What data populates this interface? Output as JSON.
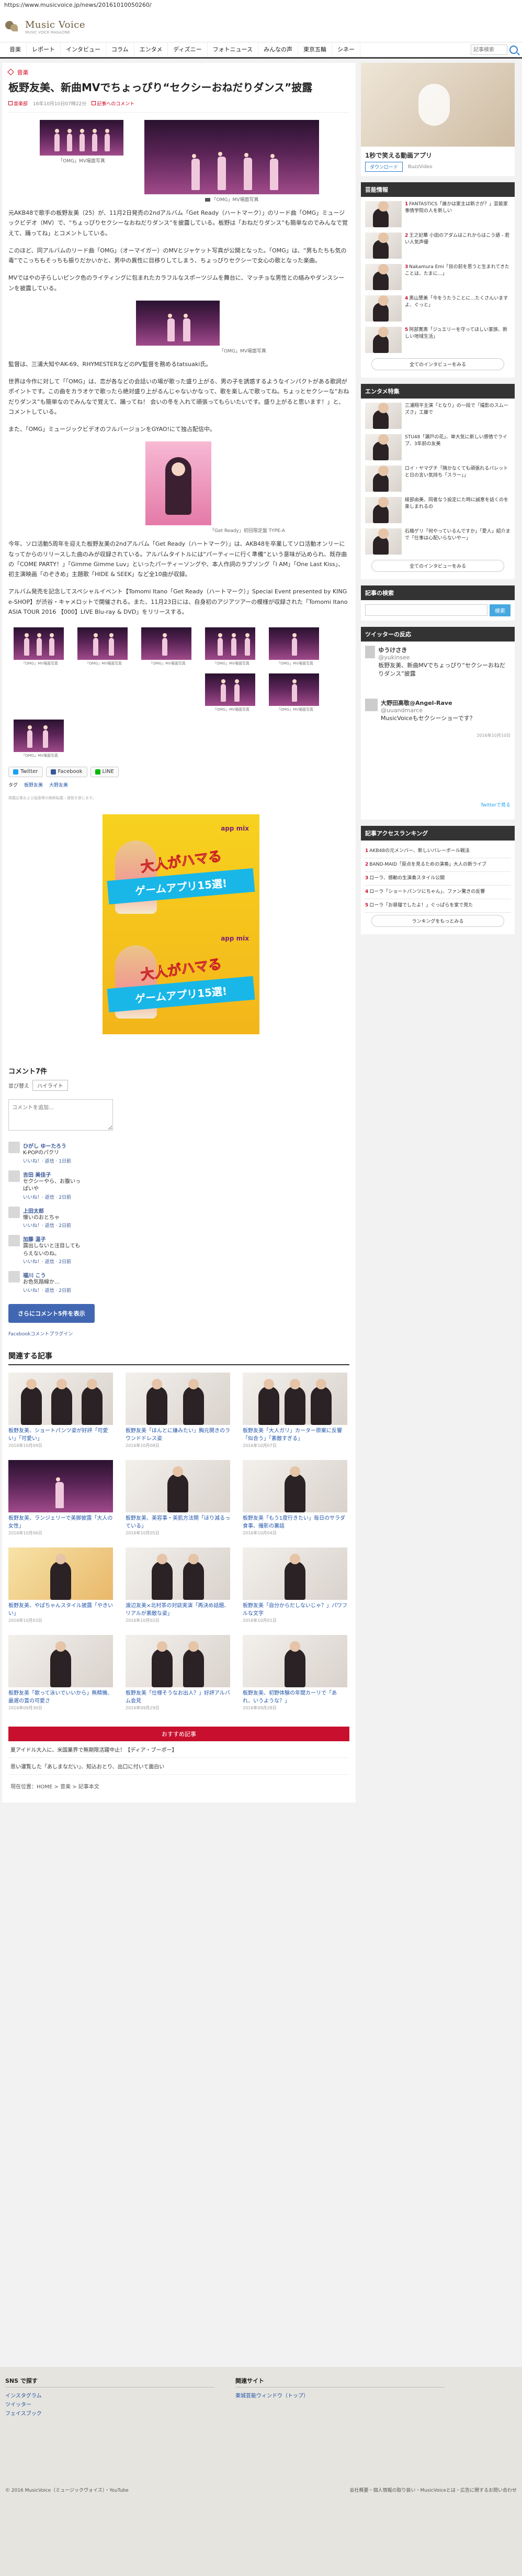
{
  "browser": {
    "url": "https://www.musicvoice.jp/news/20161010050260/"
  },
  "site": {
    "logo_text": "Music Voice",
    "logo_sub": "MUSIC VOICE MAGAZINE"
  },
  "nav": {
    "items": [
      "音楽",
      "レポート",
      "インタビュー",
      "コラム",
      "エンタメ",
      "ディズニー",
      "フォトニュース",
      "みんなの声",
      "東京五輪",
      "シネー"
    ],
    "search_placeholder": "記事検索"
  },
  "article": {
    "category": "音楽",
    "title": "板野友美、新曲MVでちょっぴり“セクシーおねだりダンス”披露",
    "author": "音楽部",
    "date": "16年10月10日07時22分",
    "comment_label": "記事へのコメント",
    "img1_caption": "「OMG」MV場面写真",
    "img2_caption": "「OMG」MV場面写真",
    "p1": "元AKB48で歌手の板野友美（25）が、11月2日発売の2ndアルバム「Get Ready（ハートマーク）」のリード曲「OMG」ミュージックビデオ（MV）で、“ちょっぴりセクシーなおねだりダンス”を披露している。板野は「おねだりダンス”も簡単なのでみんなで覚えて、踊ってね」とコメントしている。",
    "p2": "このほど、同アルバムのリード曲「OMG」（オーマイガー）のMVとジャケット写真が公開となった。「OMG」は、“男もたちも気の毒”でこっちもそっちも振りだかいかと、男中の異性に目移りしてしまう、ちょっぴりセクシーで女心の歌となった楽曲。",
    "p3": "MVではやの子らしいピンク色のライティングに包まれたカラフルなスポーツジムを舞台に、マッチョな男性との絡みやダンスシーンを披露している。",
    "img3_caption": "「OMG」MV場面写真",
    "p4": "監督は、三浦大知やAK-69、RHYMESTERなどのPV監督を務めるtatsuaki氏。",
    "p5": "世界は今作に対して「「OMG」は、恋が各などの会話いの場が歌った盛り上がる、男の子を誘惑するようなインパクトがある歌詞がポイントです。この曲をカラオケで歌ったら絶対盛り上がるんじゃないかなって、歌を楽しんで歌ってね。ちょっとセクシーな“おねだりダンス”も簡単なのでみんなで覚えて、踊ってね！ 会いの冬を入れて頑張ってもらいたいです。盛り上がると思います！」と、コメントしている。",
    "p6": "また、「OMG」ミュージックビデオのフルバージョンをGYAO!にて独占配信中。",
    "img4_caption": "「Get Ready」初回限定盤 TYPE-A",
    "p7": "今年、ソロ活動5周年を迎えた板野友美の2ndアルバム「Get Ready（ハートマーク）」は、AKB48を卒業してソロ活動オンリーになってからのリリースした曲のみが収録されている。アルバムタイトルには“パーティーに行く準備”という意味が込められ、既存曲の「COME PARTY！」「Gimme Gimme Luv」といったパーティーソングや、本人作詞のラブソング「I AM」「One Last Kiss」、初主演映画「のぞきめ」主題歌「HIDE & SEEK」など全10曲が収録。",
    "p8": "アルバム発売を記念してスペシャルイベント【Tomomi Itano「Get Ready（ハートマーク）」Special Event presented by KING e-SHOP】が渋谷・キャメロットで開催される。また、11月23日には、自身初のアジアツアーの模様が収録された「Tomomi Itano ASIA TOUR 2016 【000】LIVE Blu-ray & DVD」をリリースする。",
    "thumb_caption": "「OMG」MV場面写真",
    "share": {
      "twitter": "Twitter",
      "facebook": "Facebook",
      "line": "LINE"
    },
    "tags": {
      "label": "タグ",
      "t1": "板野友美",
      "t2": "大野友美"
    },
    "notice": "掲載記事および画像等の無断転載・複製を禁じます。"
  },
  "ad": {
    "brand": "app mix",
    "headline": "大人がハマる",
    "subline": "ゲームアプリ15選!"
  },
  "comments": {
    "header": "コメント7件",
    "sort_label": "並び替え",
    "sort_value": "ハイライト",
    "input_placeholder": "コメントを追加...",
    "items": [
      {
        "name": "ひがし ゆーたろう",
        "text": "K-POPのパクリ",
        "action": "いいね！· 返信 · 1日前"
      },
      {
        "name": "吉田 美佳子",
        "text": "セクシーやら、お腹いっぱいや",
        "action": "いいね！· 返信 · 2日前"
      },
      {
        "name": "上田太郎",
        "text": "懐いのおとちゃ",
        "action": "いいね！· 返信 · 2日前"
      },
      {
        "name": "加藤 温子",
        "text": "露出しないと注目してもらえないのね。",
        "action": "いいね！· 返信 · 2日前"
      },
      {
        "name": "福川 こう",
        "text": "お色気路線か…",
        "action": "いいね！· 返信 · 2日前"
      }
    ],
    "more_button": "さらにコメント5件を表示",
    "plugin": "Facebookコメントプラグイン"
  },
  "related": {
    "title": "関連する記事",
    "items": [
      {
        "title": "板野友美、ショートパンツ姿が好評「可愛い」「可愛い」",
        "date": "2016年10月09日"
      },
      {
        "title": "板野友美「ほんとに嫌みたい」胸元開きのラウンドドレス姿",
        "date": "2016年10月08日"
      },
      {
        "title": "板野友美「大人ガリ」カーター原案に反響「似合う」「素敵すぎる」",
        "date": "2016年10月07日"
      },
      {
        "title": "板野友美、ランジェリーで美脚披露「大人の女性」",
        "date": "2016年10月06日"
      },
      {
        "title": "板野友美、美容事・美肌方法開「ほり減るっている」",
        "date": "2016年10月05日"
      },
      {
        "title": "板野友美「もう1度行きたい」毎日のサラダ食事、撮影の裏話",
        "date": "2016年10月04日"
      },
      {
        "title": "板野友美、やぱちゃんスタイル披露「やきいい」",
        "date": "2016年10月03日"
      },
      {
        "title": "渡辺友美×北村茶の対談実演「再決め話題、リアルが素敵な姿」",
        "date": "2016年10月02日"
      },
      {
        "title": "板野友美「自分からだしないじゃ？」パワフルな文字",
        "date": "2016年10月01日"
      },
      {
        "title": "板野友美「歌って泳いでいいから」無精機、最遅の賞の可愛さ",
        "date": "2016年09月30日"
      },
      {
        "title": "板野友美「仕様そうなお出人？」好評アルバム会見",
        "date": "2016年09月29日"
      },
      {
        "title": "板野友美、初野体験の年間カーリで「あれ、いうような？」",
        "date": "2016年09月28日"
      }
    ]
  },
  "recommend": {
    "bar": "おすすめ記事",
    "l1": "夏アイドル大入に、米国業界で無期限活躍中止！【ディア・ブーポー】",
    "l2": "思い運覧した「あしまなだい」、知込おとり、出口に付いて面白い"
  },
  "breadcrumb": "現在位置：HOME > 音楽 > 記事本文",
  "sidebar": {
    "app_title": "1秒で笑える動画アプリ",
    "app_download": "ダウンロード",
    "app_brand": "BuzzVideo",
    "ranking_title": "芸能情報",
    "ranking": [
      {
        "num": "1",
        "text": "FANTASTICS「誰かは家主は新さが？」芸能家事情学院の人を新しい"
      },
      {
        "num": "2",
        "text": "王之妃華 小田のアダムはこれからはこう語 - 若い人気声優"
      },
      {
        "num": "3",
        "text": "Nakamura Emi「目の前を思うと生まれてきたことは、たまに…」"
      },
      {
        "num": "4",
        "text": "黒山慧美「今をうたうことに…たくさんいますよ、ぐっと」"
      },
      {
        "num": "5",
        "text": "阿部寛斎「ジュエリーを守ってほしい家族、新しい地域生活」"
      }
    ],
    "ranking_more": "全てのインタビューをみる",
    "entame_title": "エンタメ特集",
    "entame": [
      {
        "text": "三浦翔平主演「となり」の一段で「撮影のスムーズさ」工藤で"
      },
      {
        "text": "STU48「瀬戸の花」、単大気に新しい感情でライブ、3年前の友美"
      },
      {
        "text": "ロイ・ヤマグチ「隣かなくても頑張れるバレットと日の言い気持ち「スラー」」"
      },
      {
        "text": "綾部由美、同者なう設定にた時に誠意を話くのを楽しまれるの"
      },
      {
        "text": "石橋ゲリ「何やっているんですか」「愛人」紹介まで「仕事は心配いらないやー」"
      }
    ],
    "entame_more": "全てのインタビューをみる",
    "search_title": "記事の検索",
    "search_button": "検索",
    "twitter_title": "ツイッターの反応",
    "tweets": [
      {
        "name": "ゆうけさき",
        "handle": "@yukinsee",
        "text": "板野友美、新曲MVでちょっぴり“セクシーおねだりダンス”披露"
      },
      {
        "name": "大野田高敬@Angel-Rave",
        "handle": "@uuandmarce",
        "text": "MusicVoiceもセクシーショーです？"
      }
    ],
    "tweet_time": "2016年10月10日",
    "tweet_more": "Twitterで見る",
    "access_title": "記事アクセスランキング",
    "access": [
      {
        "num": "1",
        "text": "AKB48の元メンバー、新しいバレーボール戦法"
      },
      {
        "num": "2",
        "text": "BAND-MAID「原点を見るための演奏」大人の新ライブ"
      },
      {
        "num": "3",
        "text": "ローラ、感動の生演奏スタイル公開"
      },
      {
        "num": "4",
        "text": "ローラ「ショートパンツにちゃん」、ファン驚きの反響"
      },
      {
        "num": "5",
        "text": "ローラ「お昼寝でしたよ！」ぐっぱらを家で見た"
      }
    ],
    "access_more": "ランキングをもっとみる"
  },
  "footer": {
    "sns_title": "SNS で探す",
    "sns_links": [
      "インスタグラム",
      "ツイッター",
      "フェイスブック"
    ],
    "related_title": "関連サイト",
    "related_link": "東城芸能ウィンドウ（トップ）",
    "copyright": "© 2016 MusicVoice（ミュージックヴォイス）・YouTube",
    "links": "会社概要・個人情報の取り扱い・MusicVoiceとは・広告に関するお問い合わせ"
  }
}
